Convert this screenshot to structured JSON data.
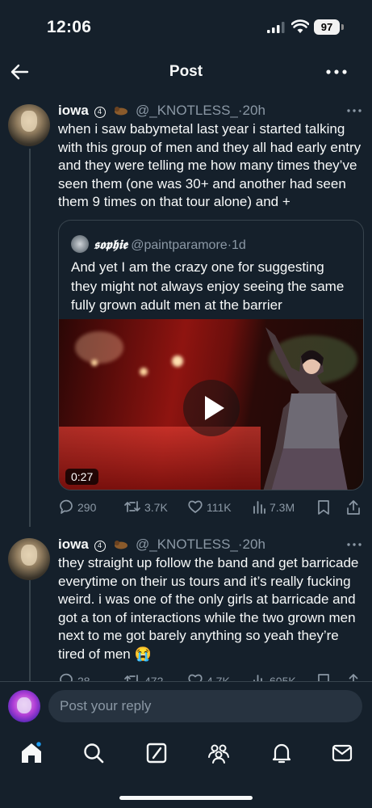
{
  "status_bar": {
    "time": "12:06",
    "battery": "97"
  },
  "header": {
    "title": "Post"
  },
  "tweets": [
    {
      "name": "iowa",
      "badge": "4",
      "handle": "@_KNOTLESS_",
      "dot": "·",
      "time": "20h",
      "text": "when i saw babymetal last year i started talking with this group of men and they all had early entry and they were telling me how many times they’ve seen them (one was 30+ and another had seen them 9 times on that tour alone) and +",
      "quote": {
        "name": "𝖘𝖔𝖕𝖍𝖎𝖊",
        "handle": "@paintparamore",
        "dot": "·",
        "time": "1d",
        "text": "And yet I am the crazy one for suggesting they might not always enjoy seeing the same fully grown adult men at the barrier",
        "video_duration": "0:27"
      },
      "stats": {
        "replies": "290",
        "reposts": "3.7K",
        "likes": "111K",
        "views": "7.3M"
      }
    },
    {
      "name": "iowa",
      "badge": "4",
      "handle": "@_KNOTLESS_",
      "dot": "·",
      "time": "20h",
      "text": "they straight up follow the band and get barricade everytime on their us tours and it’s really fucking weird. i was one of the only girls at barricade and got a ton of interactions while the two grown men next to me got barely anything so yeah they’re tired of men 😭",
      "stats": {
        "replies": "28",
        "reposts": "472",
        "likes": "4.7K",
        "views": "605K"
      }
    }
  ],
  "reply_box": {
    "placeholder": "Post your reply"
  },
  "tab_bar": {
    "items": [
      "home-icon",
      "search-icon",
      "grok-icon",
      "communities-icon",
      "notifications-icon",
      "messages-icon"
    ],
    "active": "home-icon",
    "notification_dot_color": "#1d9bf0"
  },
  "colors": {
    "background": "#15202b",
    "text": "#f7f9f9",
    "secondary": "#8b98a5",
    "divider": "#38444d"
  }
}
